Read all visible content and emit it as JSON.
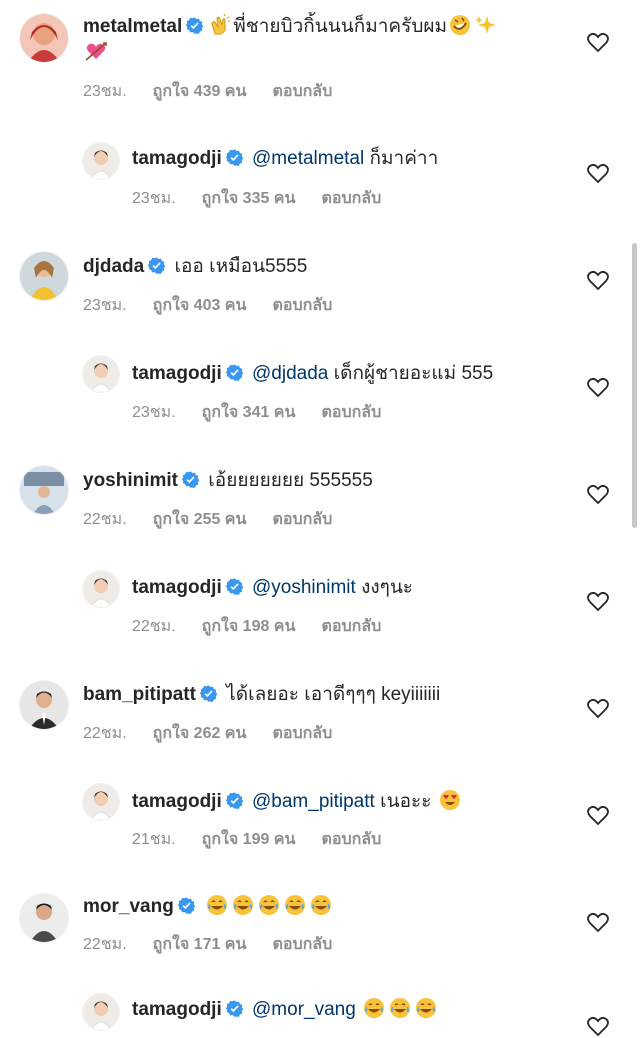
{
  "comments": [
    {
      "user": "metalmetal",
      "text": "พี่ชายบิวกิ้นนนก็มาครับผม",
      "mention": "",
      "time": "23ชม.",
      "likes": "ถูกใจ 439 คน",
      "reply": "ตอบกลับ",
      "avatar_color": "#d9534f",
      "is_reply": false
    },
    {
      "user": "tamagodji",
      "text": "ก็มาค่าา",
      "mention": "@metalmetal",
      "time": "23ชม.",
      "likes": "ถูกใจ 335 คน",
      "reply": "ตอบกลับ",
      "avatar_color": "#e8e3de",
      "is_reply": true
    },
    {
      "user": "djdada",
      "text": "เออ เหมือน5555",
      "mention": "",
      "time": "23ชม.",
      "likes": "ถูกใจ 403 คน",
      "reply": "ตอบกลับ",
      "avatar_color": "#caa23a",
      "is_reply": false
    },
    {
      "user": "tamagodji",
      "text": "เด็กผู้ชายอะแม่ 555",
      "mention": "@djdada",
      "time": "23ชม.",
      "likes": "ถูกใจ 341 คน",
      "reply": "ตอบกลับ",
      "avatar_color": "#e8e3de",
      "is_reply": true
    },
    {
      "user": "yoshinimit",
      "text": "เอ้ยยยยยยย 555555",
      "mention": "",
      "time": "22ชม.",
      "likes": "ถูกใจ 255 คน",
      "reply": "ตอบกลับ",
      "avatar_color": "#7c8ea3",
      "is_reply": false
    },
    {
      "user": "tamagodji",
      "text": "งงๆนะ",
      "mention": "@yoshinimit",
      "time": "22ชม.",
      "likes": "ถูกใจ 198 คน",
      "reply": "ตอบกลับ",
      "avatar_color": "#e8e3de",
      "is_reply": true
    },
    {
      "user": "bam_pitipatt",
      "text": "ได้เลยอะ เอาดีๆๆๆ keyiiiiiii",
      "mention": "",
      "time": "22ชม.",
      "likes": "ถูกใจ 262 คน",
      "reply": "ตอบกลับ",
      "avatar_color": "#3d3d3d",
      "is_reply": false
    },
    {
      "user": "tamagodji",
      "text": "เนอะะ",
      "mention": "@bam_pitipatt",
      "time": "21ชม.",
      "likes": "ถูกใจ 199 คน",
      "reply": "ตอบกลับ",
      "avatar_color": "#e8e3de",
      "is_reply": true
    },
    {
      "user": "mor_vang",
      "text": "",
      "mention": "",
      "time": "22ชม.",
      "likes": "ถูกใจ 171 คน",
      "reply": "ตอบกลับ",
      "avatar_color": "#4a4a4a",
      "is_reply": false
    },
    {
      "user": "tamagodji",
      "text": "",
      "mention": "@mor_vang",
      "time": "",
      "likes": "",
      "reply": "",
      "avatar_color": "#e8e3de",
      "is_reply": true
    }
  ],
  "icons": {
    "verified": "verified-badge-icon",
    "like": "heart-outline-icon"
  },
  "colors": {
    "verified": "#3897f0",
    "mention": "#00376b",
    "meta": "#8e8e8e"
  }
}
